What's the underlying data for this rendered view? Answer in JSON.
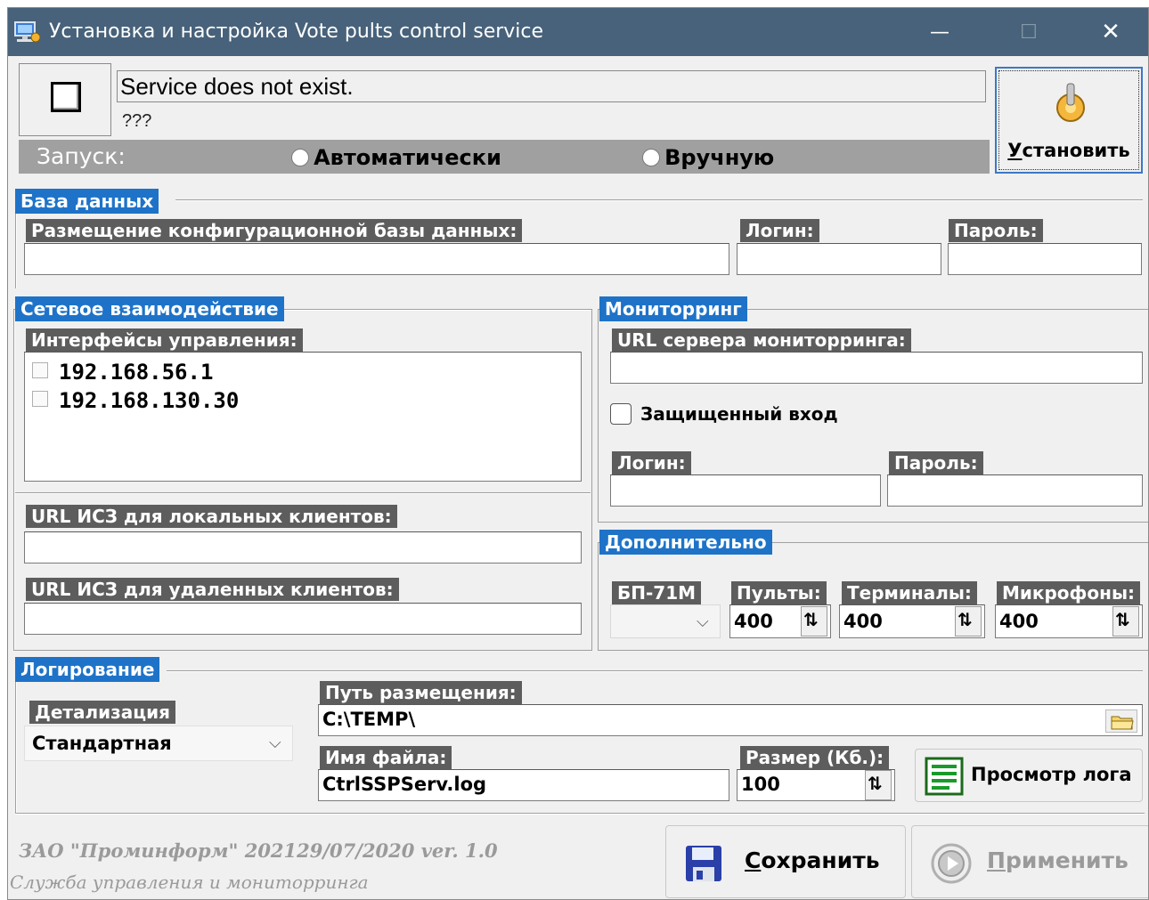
{
  "window": {
    "title": "Установка и настройка  Vote pults control service",
    "minimize_glyph": "—",
    "maximize_glyph": "☐",
    "close_glyph": "✕"
  },
  "service": {
    "status": "Service does not exist.",
    "substatus": "???",
    "startup_label": "Запуск:",
    "auto_label": "Автоматически",
    "manual_label": "Вручную",
    "install_button": "Установить",
    "install_mnemonic": "У",
    "install_rest": "становить"
  },
  "database": {
    "section_title": "База данных",
    "location_label": "Размещение конфигурационной базы данных:",
    "location_value": "",
    "login_label": "Логин:",
    "login_value": "",
    "password_label": "Пароль:",
    "password_value": ""
  },
  "network": {
    "section_title": "Сетевое взаимодействие",
    "interfaces_label": "Интерфейсы управления:",
    "interfaces": [
      {
        "address": "192.168.56.1",
        "checked": false
      },
      {
        "address": "192.168.130.30",
        "checked": false
      }
    ],
    "local_url_label": "URL ИСЗ для локальных клиентов:",
    "local_url_value": "",
    "remote_url_label": "URL ИСЗ для удаленных клиентов:",
    "remote_url_value": ""
  },
  "monitoring": {
    "section_title": "Мониторринг",
    "server_url_label": "URL сервера мониторринга:",
    "server_url_value": "",
    "secure_login_label": "Защищенный вход",
    "secure_login_checked": false,
    "login_label": "Логин:",
    "login_value": "",
    "password_label": "Пароль:",
    "password_value": ""
  },
  "additional": {
    "section_title": "Дополнительно",
    "bp_label": "БП-71М",
    "bp_value": "",
    "remotes_label": "Пульты:",
    "remotes_value": "400",
    "terminals_label": "Терминалы:",
    "terminals_value": "400",
    "microphones_label": "Микрофоны:",
    "microphones_value": "400"
  },
  "logging": {
    "section_title": "Логирование",
    "detail_label": "Детализация",
    "detail_value": "Стандартная",
    "path_label": "Путь размещения:",
    "path_value": "C:\\TEMP\\",
    "filename_label": "Имя файла:",
    "filename_value": "CtrlSSPServ.log",
    "size_label": "Размер (Кб.):",
    "size_value": "100",
    "view_log_button": "Просмотр лога"
  },
  "footer": {
    "company": "ЗАО \"Проминформ\"   202129/07/2020 ver. 1.0",
    "subtitle": "Служба управления и мониторринга",
    "save_mnemonic": "С",
    "save_rest": "охранить",
    "apply_mnemonic": "П",
    "apply_rest": "рименить"
  },
  "colors": {
    "titlebar": "#47627a",
    "section_blue": "#1e73c8",
    "caption_gray": "#5d5d5d",
    "startup_bar": "#a0a0a0",
    "window_bg": "#f0f0f0"
  }
}
